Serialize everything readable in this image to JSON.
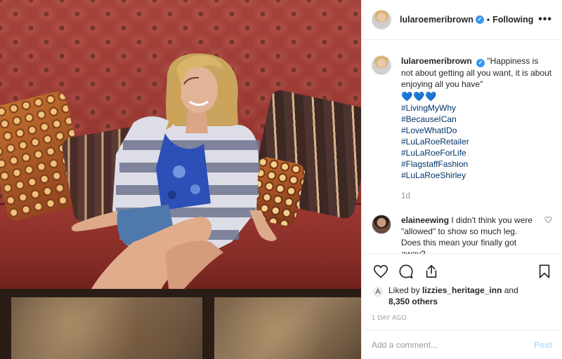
{
  "header": {
    "username": "lularoemeribrown",
    "verified_icon": "verified-badge-icon",
    "separator": "•",
    "follow_label": "Following",
    "more_icon": "more-options-icon",
    "more_glyph": "•••"
  },
  "caption": {
    "username": "lularoemeribrown",
    "text": "\"Happiness is not about getting all you want, it is about enjoying all you have\"",
    "hearts": "💙💙💙",
    "hashtags": [
      "#LivingMyWhy",
      "#BecauseICan",
      "#LoveWhatIDo",
      "#LuLaRoeRetailer",
      "#LuLaRoeForLife",
      "#FlagstaffFashion",
      "#LuLaRoeShirley"
    ],
    "time": "1d"
  },
  "comment": {
    "username": "elaineewing",
    "text": "I didn't think you were \"allowed\" to show so much leg. Does this mean your finally got away?",
    "like_icon": "heart-outline-icon"
  },
  "actions": {
    "like_icon": "heart-icon",
    "comment_icon": "comment-icon",
    "share_icon": "share-icon",
    "bookmark_icon": "bookmark-icon"
  },
  "likes": {
    "prefix": "Liked by ",
    "user": "lizzies_heritage_inn",
    "middle": " and",
    "count": "8,350 others"
  },
  "date": "1 DAY AGO",
  "add_comment": {
    "placeholder": "Add a comment...",
    "post_label": "Post"
  },
  "colors": {
    "link": "#003569",
    "verified": "#3897f0",
    "post_disabled": "#b2dffc",
    "muted": "#999999"
  }
}
